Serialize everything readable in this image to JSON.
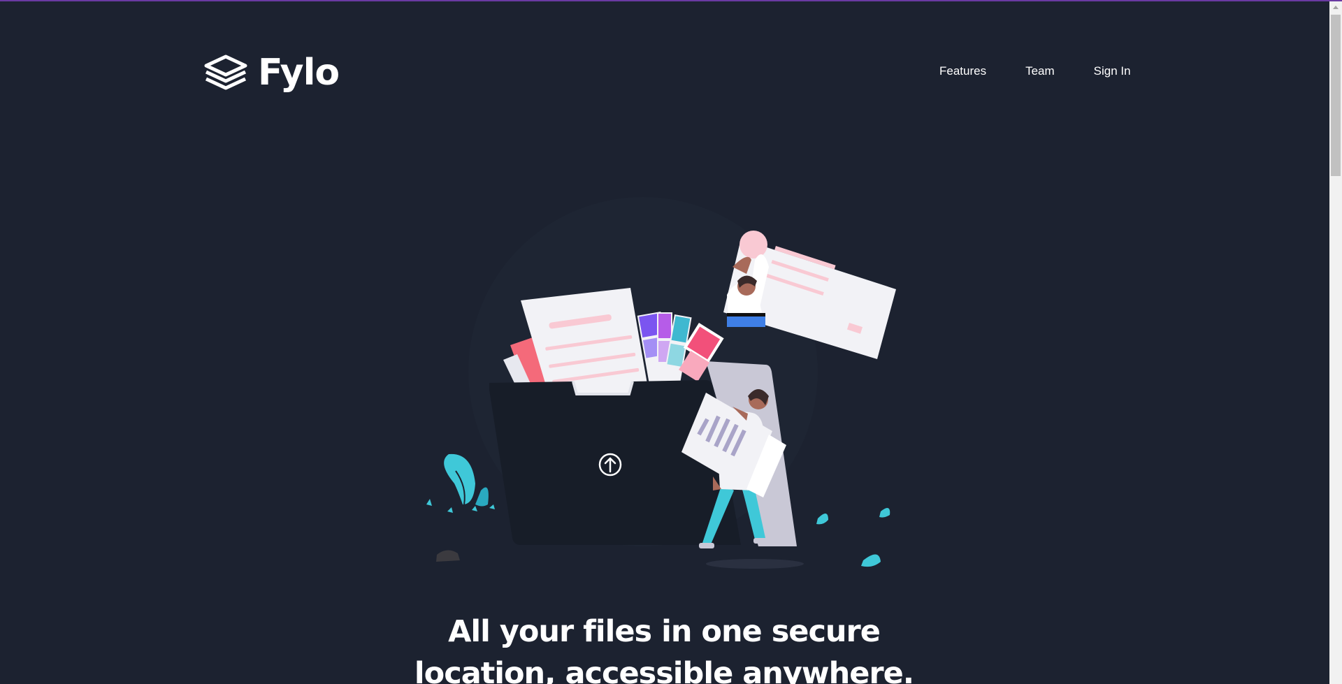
{
  "app": {
    "logo_text": "Fylo"
  },
  "nav": {
    "items": [
      {
        "label": "Features"
      },
      {
        "label": "Team"
      },
      {
        "label": "Sign In"
      }
    ]
  },
  "hero": {
    "headline": "All your files in one secure location, accessible anywhere.",
    "illustration": "people-uploading-files-to-folder-illustration",
    "upload_icon": "arrow-up-circle-icon"
  },
  "colors": {
    "background": "#1c2230",
    "text": "#ffffff",
    "top_accent": "#6a3aa2",
    "folder": "#171d28",
    "accent_cyan": "#3fc8d8",
    "accent_pink": "#f8a7b8"
  }
}
